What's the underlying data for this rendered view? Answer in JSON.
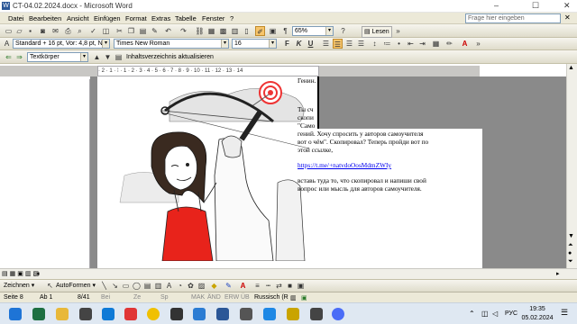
{
  "window": {
    "title": "CT-04.02.2024.docx - Microsoft Word",
    "controls": [
      "–",
      "☐",
      "✕"
    ]
  },
  "menu": {
    "items": [
      "Datei",
      "Bearbeiten",
      "Ansicht",
      "Einfügen",
      "Format",
      "Extras",
      "Tabelle",
      "Fenster",
      "?"
    ],
    "help_placeholder": "Frage hier eingeben"
  },
  "toolbar_standard": {
    "zoom": "65%",
    "read_label": "Lesen"
  },
  "toolbar_format": {
    "style": "Standard + 16 pt, Vor: 4,8 pt, N",
    "font": "Times New Roman",
    "size": "16",
    "bold": "F",
    "italic": "K",
    "underline": "U"
  },
  "toolbar_outline": {
    "style": "Textkörper",
    "update_toc": "Inhaltsverzeichnis aktualisieren"
  },
  "ruler": {
    "text": "· 2 · 1 · ⁞ · 1 · 2 · 3 · 4 · 5 · 6 · 7 · 8 · 9 · 10 · 11 · 12 · 13 · 14"
  },
  "document": {
    "line_top": "Генин.",
    "line_a1": "Ты сч",
    "line_a2": "скопи",
    "line_a3": "\"Само",
    "para1": [
      "гений. Хочу спросить у авторов самоучителя",
      "вот о чём\". Скопировал? Теперь пройди вот по",
      "этой ссылке,"
    ],
    "link": "https://t.me/+natvdoOosMdmZWIy",
    "para2": [
      "вставь туда то, что скопировал и напиши свой",
      "вопрос или мысль для авторов самоучителя."
    ]
  },
  "drawing_toolbar": {
    "draw_label": "Zeichnen ▾",
    "autoshapes_label": "AutoFormen ▾"
  },
  "status": {
    "page": "Seite 8",
    "section": "Ab 1",
    "pages": "8/41",
    "at": "Bei",
    "line": "Ze",
    "col": "Sp",
    "mak": "MAK",
    "and": "ÄND",
    "erw": "ERW",
    "ub": "ÜB",
    "language": "Russisch (R"
  },
  "taskbar": {
    "lang": "РУС",
    "time": "19:35",
    "date": "05.02.2024"
  },
  "colors": {
    "menubar": "#ece9d8",
    "taskbar": "#dfe8f2",
    "link": "#0000ee",
    "dress": "#e8231b",
    "hair": "#3a2a20"
  }
}
